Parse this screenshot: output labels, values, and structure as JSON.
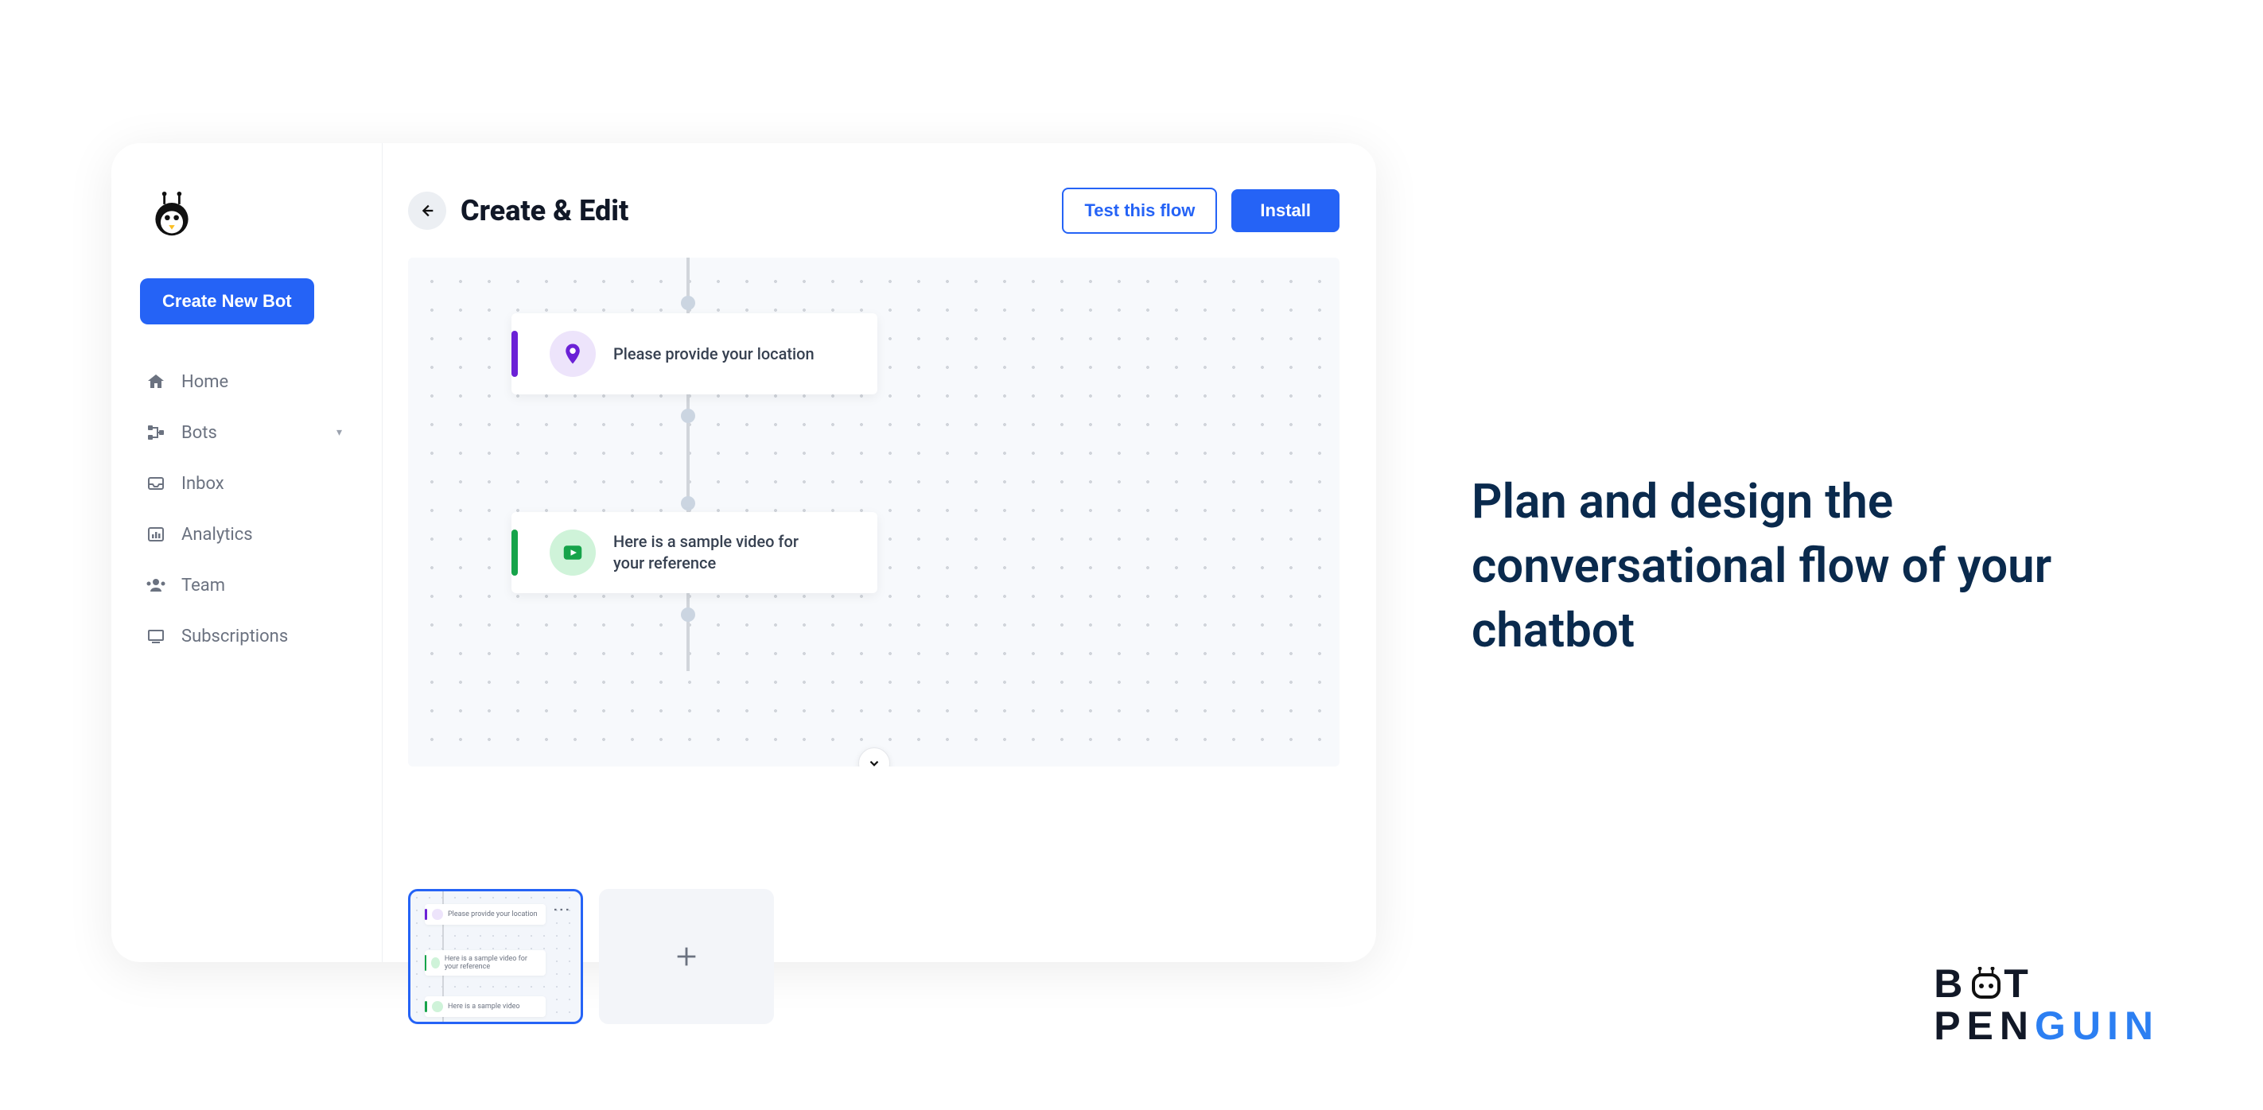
{
  "sidebar": {
    "createLabel": "Create New Bot",
    "items": [
      {
        "label": "Home"
      },
      {
        "label": "Bots"
      },
      {
        "label": "Inbox"
      },
      {
        "label": "Analytics"
      },
      {
        "label": "Team"
      },
      {
        "label": "Subscriptions"
      }
    ]
  },
  "topbar": {
    "title": "Create & Edit",
    "testLabel": "Test this flow",
    "installLabel": "Install"
  },
  "flow": {
    "nodes": [
      {
        "text": "Please provide your location",
        "accent": "purple",
        "icon": "location"
      },
      {
        "text": "Here is a sample video for your reference",
        "accent": "green",
        "icon": "video"
      }
    ],
    "thumbnail": {
      "miniNodes": [
        {
          "text": "Please provide your location",
          "accent": "purple"
        },
        {
          "text": "Here is a sample video for your reference",
          "accent": "green"
        },
        {
          "text": "Here is a sample video",
          "accent": "green"
        }
      ]
    }
  },
  "hero": {
    "text": "Plan and design the conversational flow of your chatbot"
  },
  "brand": {
    "line1a": "B",
    "line1b": "T",
    "line2a": "PEN",
    "line2b": "GUIN"
  }
}
